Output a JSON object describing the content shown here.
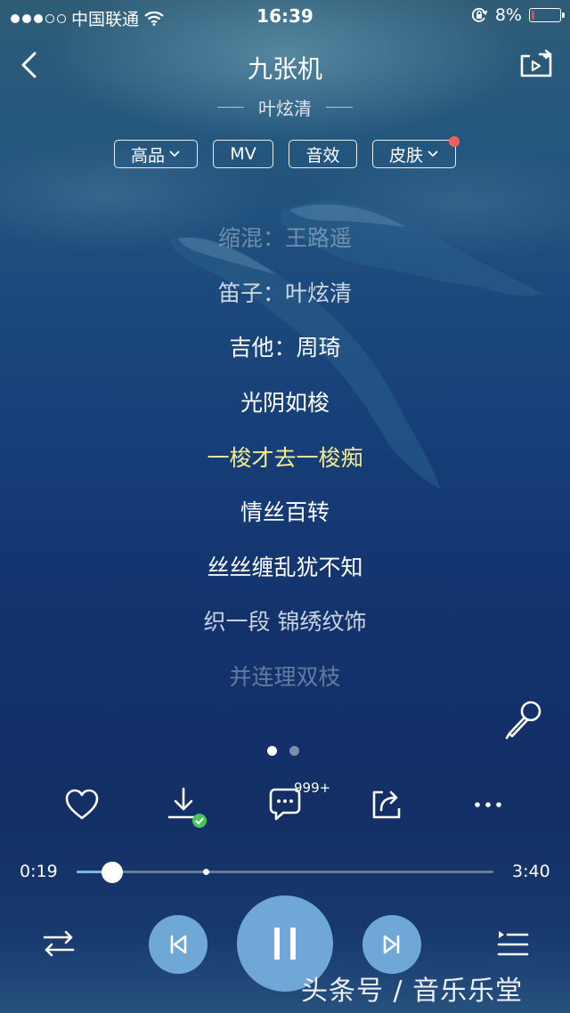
{
  "status_bar": {
    "carrier": "中国联通",
    "time": "16:39",
    "battery_percent": "8%",
    "battery_level": 0.08,
    "signal_bars_filled": 3,
    "signal_bars_total": 5,
    "icons": [
      "wifi-icon",
      "rotation-lock-icon",
      "battery-icon"
    ]
  },
  "header": {
    "song_title": "九张机",
    "artist": "叶炫清",
    "back_icon": "chevron-left-icon",
    "cast_icon": "screen-cast-icon"
  },
  "chips": {
    "quality": "高品",
    "mv": "MV",
    "effect": "音效",
    "skin": "皮肤",
    "skin_has_notice": true
  },
  "lyrics": [
    {
      "text": "缩混：王路遥",
      "state": "faint"
    },
    {
      "text": "笛子：叶炫清",
      "state": "mid"
    },
    {
      "text": "吉他：周琦",
      "state": "on"
    },
    {
      "text": "光阴如梭",
      "state": "on"
    },
    {
      "text": "一梭才去一梭痴",
      "state": "current"
    },
    {
      "text": "情丝百转",
      "state": "on"
    },
    {
      "text": "丝丝缠乱犹不知",
      "state": "on"
    },
    {
      "text": "织一段 锦绣纹饰",
      "state": "mid"
    },
    {
      "text": "并连理双枝",
      "state": "faint"
    }
  ],
  "pager": {
    "pages": 2,
    "active": 1
  },
  "actions": {
    "comment_count": "999+",
    "icons": [
      "heart-icon",
      "download-icon",
      "comment-icon",
      "share-icon",
      "more-icon"
    ],
    "downloaded": true
  },
  "progress": {
    "current": "0:19",
    "total": "3:40",
    "played_fraction": 0.086,
    "buffered_fraction": 0.31
  },
  "controls": {
    "icons": [
      "shuffle-icon",
      "previous-icon",
      "pause-icon",
      "next-icon",
      "playlist-icon"
    ]
  },
  "watermark": "头条号 / 音乐乐堂",
  "colors": {
    "current_lyric": "#f3ec8e",
    "button_fill": "#6fa8d6",
    "progress_played": "#7fb4e0",
    "download_badge": "#4cc25a",
    "notice_dot": "#f0605a",
    "battery_low": "#e64a3b"
  }
}
